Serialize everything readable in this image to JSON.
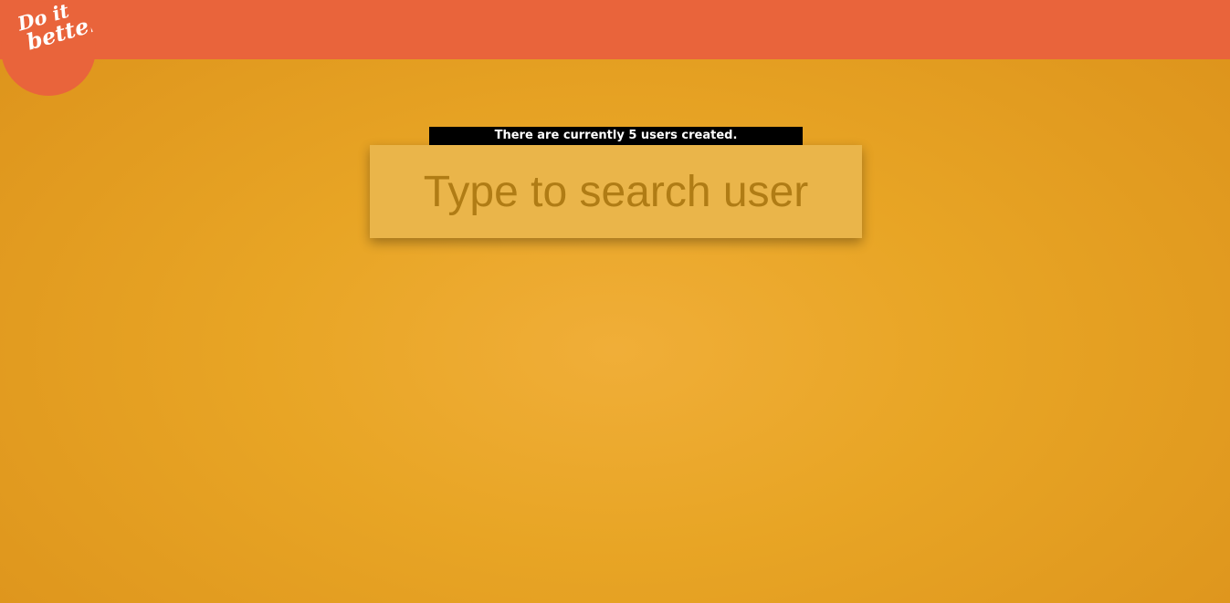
{
  "header": {
    "logo": {
      "line1": "Do it",
      "line2": "better",
      "icon": "do-it-better-logo"
    }
  },
  "main": {
    "user_count_text": "There are currently 5 users created.",
    "search": {
      "placeholder": "Type to search user",
      "value": ""
    }
  },
  "colors": {
    "header_bg": "#e9643b",
    "page_bg": "#e8a525",
    "search_bg": "#eab54a",
    "placeholder": "#b07c15",
    "count_bar_bg": "#000000",
    "count_bar_text": "#ffffff"
  }
}
